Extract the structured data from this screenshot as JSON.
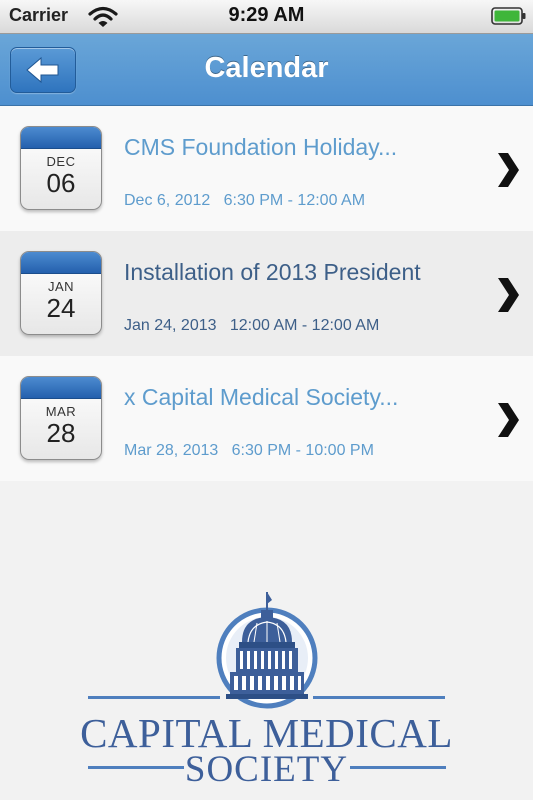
{
  "status_bar": {
    "carrier": "Carrier",
    "time": "9:29 AM",
    "icons": [
      "wifi-icon",
      "battery-icon"
    ]
  },
  "nav": {
    "title": "Calendar",
    "back_icon": "back-arrow-icon",
    "bar_color": "#5a9ad3"
  },
  "events": [
    {
      "month": "DEC",
      "day": "06",
      "title": "CMS Foundation Holiday...",
      "datetime": "Dec 6, 2012   6:30 PM - 12:00 AM",
      "text_color": "#5e9ccd"
    },
    {
      "month": "JAN",
      "day": "24",
      "title": "Installation of 2013 President",
      "datetime": "Jan 24, 2013   12:00 AM - 12:00 AM",
      "text_color": "#3d5f88"
    },
    {
      "month": "MAR",
      "day": "28",
      "title": " x Capital Medical Society...",
      "datetime": "Mar 28, 2013   6:30 PM - 10:00 PM",
      "text_color": "#5e9ccd"
    }
  ],
  "logo": {
    "line1": "CAPITAL MEDICAL",
    "line2": "SOCIETY",
    "color": "#3d5f9a"
  }
}
